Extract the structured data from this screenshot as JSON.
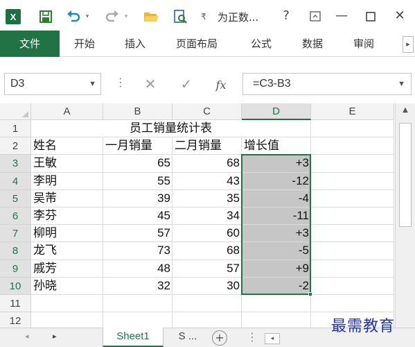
{
  "app": {
    "logo": "X",
    "document_title": "为正数...",
    "help": "?",
    "qa_icons": [
      "save-icon",
      "undo-icon",
      "redo-icon",
      "open-folder-icon",
      "preview-icon",
      "customize-icon"
    ]
  },
  "ribbon": {
    "tabs": [
      "文件",
      "开始",
      "插入",
      "页面布局",
      "公式",
      "数据",
      "审阅"
    ]
  },
  "formula_bar": {
    "name_box": "D3",
    "cancel": "✕",
    "enter": "✓",
    "fx": "fx",
    "formula": "=C3-B3"
  },
  "grid": {
    "columns": [
      "A",
      "B",
      "C",
      "D",
      "E"
    ],
    "selected_column": "D",
    "rows": [
      "1",
      "2",
      "3",
      "4",
      "5",
      "6",
      "7",
      "8",
      "9",
      "10",
      "11",
      "12"
    ],
    "title": "员工销量统计表",
    "headers": [
      "姓名",
      "一月销量",
      "二月销量",
      "增长值"
    ],
    "data": [
      {
        "name": "王敏",
        "jan": "65",
        "feb": "68",
        "growth": "+3"
      },
      {
        "name": "李明",
        "jan": "55",
        "feb": "43",
        "growth": "-12"
      },
      {
        "name": "吴芾",
        "jan": "39",
        "feb": "35",
        "growth": "-4"
      },
      {
        "name": "李芬",
        "jan": "45",
        "feb": "34",
        "growth": "-11"
      },
      {
        "name": "柳明",
        "jan": "57",
        "feb": "60",
        "growth": "+3"
      },
      {
        "name": "龙飞",
        "jan": "73",
        "feb": "68",
        "growth": "-5"
      },
      {
        "name": "戚芳",
        "jan": "48",
        "feb": "57",
        "growth": "+9"
      },
      {
        "name": "孙晓",
        "jan": "32",
        "feb": "30",
        "growth": "-2"
      }
    ]
  },
  "sheets": {
    "active": "Sheet1",
    "next": "S ...",
    "add": "+"
  },
  "watermark": "最需教育",
  "colors": {
    "accent": "#217346",
    "highlight": "#c6c6c6",
    "watermark": "#2234a8"
  }
}
